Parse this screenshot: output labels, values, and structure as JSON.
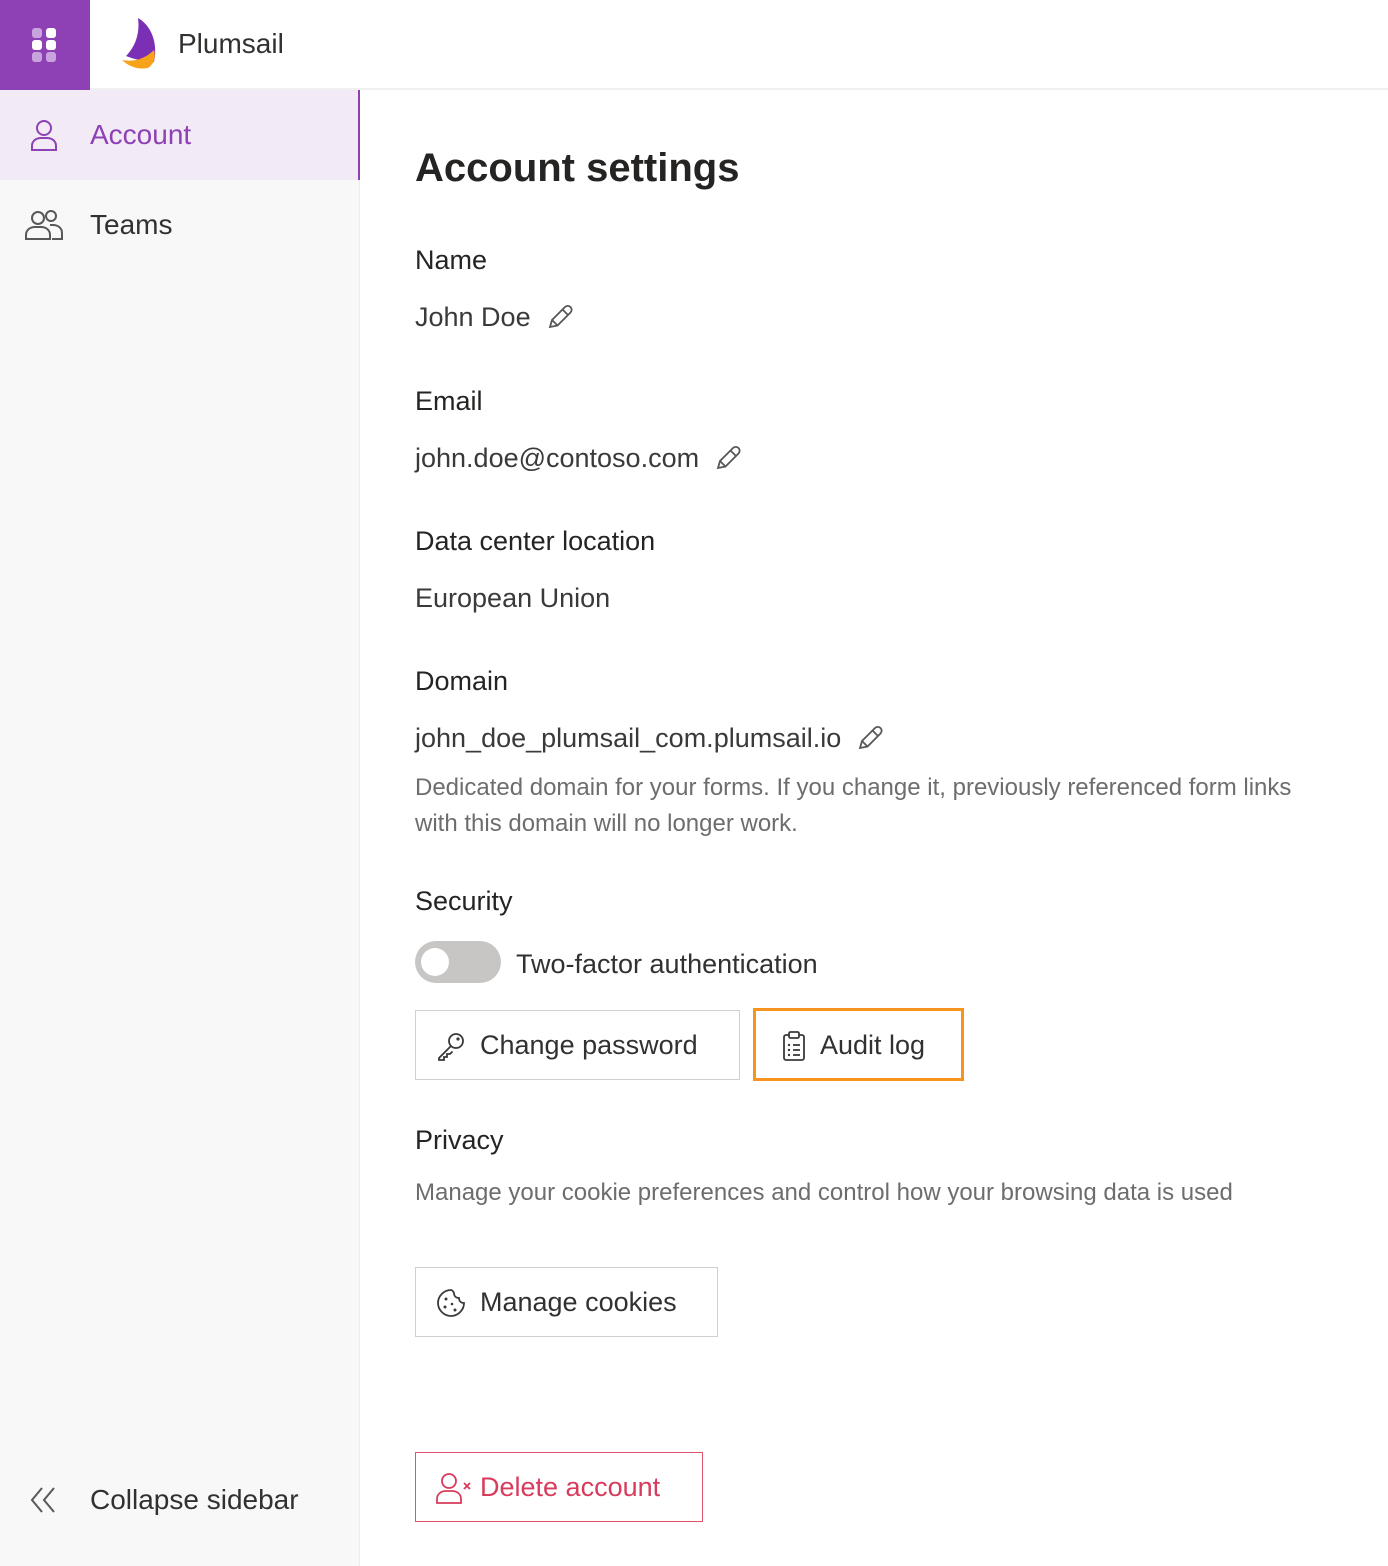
{
  "app": {
    "brand_name": "Plumsail"
  },
  "sidebar": {
    "items": [
      {
        "label": "Account",
        "icon": "person-icon",
        "active": true
      },
      {
        "label": "Teams",
        "icon": "people-icon",
        "active": false
      }
    ],
    "collapse_label": "Collapse sidebar"
  },
  "page": {
    "title": "Account settings",
    "name": {
      "label": "Name",
      "value": "John Doe"
    },
    "email": {
      "label": "Email",
      "value": "john.doe@contoso.com"
    },
    "data_center": {
      "label": "Data center location",
      "value": "European Union"
    },
    "domain": {
      "label": "Domain",
      "value": "john_doe_plumsail_com.plumsail.io",
      "help": "Dedicated domain for your forms. If you change it, previously referenced form links with this domain will no longer work."
    },
    "security": {
      "label": "Security",
      "two_factor_label": "Two-factor authentication",
      "two_factor_enabled": false,
      "change_password_label": "Change password",
      "audit_log_label": "Audit log"
    },
    "privacy": {
      "label": "Privacy",
      "help": "Manage your cookie preferences and control how your browsing data is used",
      "manage_cookies_label": "Manage cookies"
    },
    "delete_account_label": "Delete account"
  },
  "colors": {
    "accent": "#8e40b5",
    "highlight": "#f7941d",
    "danger": "#d83b5b"
  }
}
